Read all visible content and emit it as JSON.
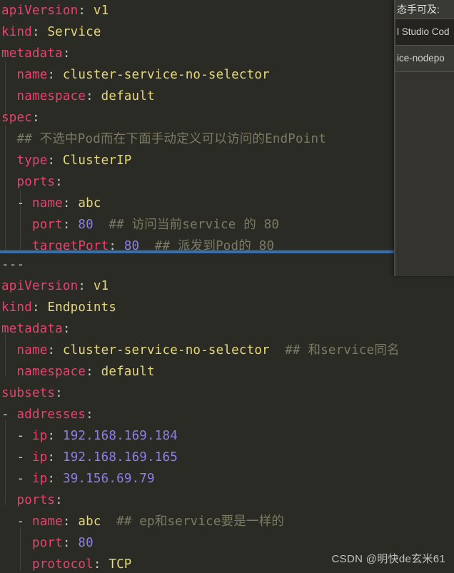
{
  "editor": {
    "theme_background": "#2b2b26",
    "colors": {
      "key": "#e8436f",
      "string": "#e5d77a",
      "number": "#8c7fe8",
      "comment": "#7b7a63",
      "punctuation": "#c8c8c8",
      "separator": "#3c6fa8"
    },
    "top_pane": {
      "name": "service-yaml-pane",
      "lines": [
        {
          "indent": 0,
          "tokens": [
            {
              "t": "apiVersion",
              "c": "k"
            },
            {
              "t": ":",
              "c": "p"
            },
            {
              "t": " v1",
              "c": "s"
            }
          ]
        },
        {
          "indent": 0,
          "tokens": [
            {
              "t": "kind",
              "c": "k"
            },
            {
              "t": ":",
              "c": "p"
            },
            {
              "t": " Service",
              "c": "s"
            }
          ]
        },
        {
          "indent": 0,
          "tokens": [
            {
              "t": "metadata",
              "c": "k"
            },
            {
              "t": ":",
              "c": "p"
            }
          ]
        },
        {
          "indent": 1,
          "tokens": [
            {
              "t": "name",
              "c": "k"
            },
            {
              "t": ":",
              "c": "p"
            },
            {
              "t": " cluster-service-no-selector",
              "c": "s"
            }
          ]
        },
        {
          "indent": 1,
          "tokens": [
            {
              "t": "namespace",
              "c": "k"
            },
            {
              "t": ":",
              "c": "p"
            },
            {
              "t": " default",
              "c": "s"
            }
          ]
        },
        {
          "indent": 0,
          "tokens": [
            {
              "t": "spec",
              "c": "k"
            },
            {
              "t": ":",
              "c": "p"
            }
          ]
        },
        {
          "indent": 1,
          "tokens": [
            {
              "t": "## 不选中Pod而在下面手动定义可以访问的EndPoint",
              "c": "c"
            }
          ]
        },
        {
          "indent": 1,
          "tokens": [
            {
              "t": "type",
              "c": "k"
            },
            {
              "t": ":",
              "c": "p"
            },
            {
              "t": " ClusterIP",
              "c": "s"
            }
          ]
        },
        {
          "indent": 1,
          "tokens": [
            {
              "t": "ports",
              "c": "k"
            },
            {
              "t": ":",
              "c": "p"
            }
          ]
        },
        {
          "indent": 1,
          "tokens": [
            {
              "t": "- ",
              "c": "p"
            },
            {
              "t": "name",
              "c": "k"
            },
            {
              "t": ":",
              "c": "p"
            },
            {
              "t": " abc",
              "c": "s"
            }
          ]
        },
        {
          "indent": 2,
          "tokens": [
            {
              "t": "port",
              "c": "k"
            },
            {
              "t": ":",
              "c": "p"
            },
            {
              "t": " ",
              "c": "p"
            },
            {
              "t": "80",
              "c": "n"
            },
            {
              "t": "  ## 访问当前service 的 80",
              "c": "c"
            }
          ]
        },
        {
          "indent": 2,
          "tokens": [
            {
              "t": "targetPort",
              "c": "k"
            },
            {
              "t": ":",
              "c": "p"
            },
            {
              "t": " ",
              "c": "p"
            },
            {
              "t": "80",
              "c": "n"
            },
            {
              "t": "  ## 派发到Pod的 80",
              "c": "c"
            }
          ]
        }
      ]
    },
    "bottom_pane": {
      "name": "endpoints-yaml-pane",
      "lines": [
        {
          "indent": 0,
          "tokens": [
            {
              "t": "---",
              "c": "d"
            }
          ]
        },
        {
          "indent": 0,
          "tokens": [
            {
              "t": "apiVersion",
              "c": "k"
            },
            {
              "t": ":",
              "c": "p"
            },
            {
              "t": " v1",
              "c": "s"
            }
          ]
        },
        {
          "indent": 0,
          "tokens": [
            {
              "t": "kind",
              "c": "k"
            },
            {
              "t": ":",
              "c": "p"
            },
            {
              "t": " Endpoints",
              "c": "s"
            }
          ]
        },
        {
          "indent": 0,
          "tokens": [
            {
              "t": "metadata",
              "c": "k"
            },
            {
              "t": ":",
              "c": "p"
            }
          ]
        },
        {
          "indent": 1,
          "tokens": [
            {
              "t": "name",
              "c": "k"
            },
            {
              "t": ":",
              "c": "p"
            },
            {
              "t": " cluster-service-no-selector",
              "c": "s"
            },
            {
              "t": "  ## 和service同名",
              "c": "c"
            }
          ]
        },
        {
          "indent": 1,
          "tokens": [
            {
              "t": "namespace",
              "c": "k"
            },
            {
              "t": ":",
              "c": "p"
            },
            {
              "t": " default",
              "c": "s"
            }
          ]
        },
        {
          "indent": 0,
          "tokens": [
            {
              "t": "subsets",
              "c": "k"
            },
            {
              "t": ":",
              "c": "p"
            }
          ]
        },
        {
          "indent": 0,
          "tokens": [
            {
              "t": "- ",
              "c": "p"
            },
            {
              "t": "addresses",
              "c": "k"
            },
            {
              "t": ":",
              "c": "p"
            }
          ]
        },
        {
          "indent": 1,
          "tokens": [
            {
              "t": "- ",
              "c": "p"
            },
            {
              "t": "ip",
              "c": "k"
            },
            {
              "t": ":",
              "c": "p"
            },
            {
              "t": " ",
              "c": "p"
            },
            {
              "t": "192.168.169.184",
              "c": "n"
            }
          ]
        },
        {
          "indent": 1,
          "tokens": [
            {
              "t": "- ",
              "c": "p"
            },
            {
              "t": "ip",
              "c": "k"
            },
            {
              "t": ":",
              "c": "p"
            },
            {
              "t": " ",
              "c": "p"
            },
            {
              "t": "192.168.169.165",
              "c": "n"
            }
          ]
        },
        {
          "indent": 1,
          "tokens": [
            {
              "t": "- ",
              "c": "p"
            },
            {
              "t": "ip",
              "c": "k"
            },
            {
              "t": ":",
              "c": "p"
            },
            {
              "t": " ",
              "c": "p"
            },
            {
              "t": "39.156.69.79",
              "c": "n"
            }
          ]
        },
        {
          "indent": 1,
          "tokens": [
            {
              "t": "ports",
              "c": "k"
            },
            {
              "t": ":",
              "c": "p"
            }
          ]
        },
        {
          "indent": 1,
          "tokens": [
            {
              "t": "- ",
              "c": "p"
            },
            {
              "t": "name",
              "c": "k"
            },
            {
              "t": ":",
              "c": "p"
            },
            {
              "t": " abc",
              "c": "s"
            },
            {
              "t": "  ## ep和service要是一样的",
              "c": "c"
            }
          ]
        },
        {
          "indent": 2,
          "tokens": [
            {
              "t": "port",
              "c": "k"
            },
            {
              "t": ":",
              "c": "p"
            },
            {
              "t": " ",
              "c": "p"
            },
            {
              "t": "80",
              "c": "n"
            }
          ]
        },
        {
          "indent": 2,
          "tokens": [
            {
              "t": "protocol",
              "c": "k"
            },
            {
              "t": ":",
              "c": "p"
            },
            {
              "t": " TCP",
              "c": "s"
            }
          ]
        }
      ]
    }
  },
  "overlay": {
    "name": "window-switcher-overlay",
    "header": "态手可及:",
    "items": [
      {
        "label": "l Studio Cod",
        "selected": true
      },
      {
        "label": "ice-nodepo",
        "selected": false
      }
    ]
  },
  "watermark": {
    "text": "CSDN @明快de玄米61"
  }
}
